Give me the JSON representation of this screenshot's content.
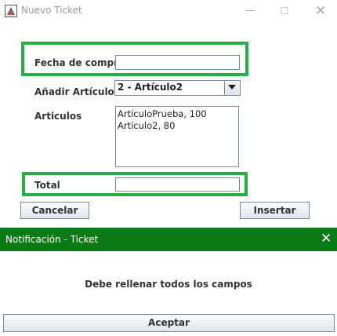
{
  "window": {
    "title": "Nuevo Ticket",
    "controls": {
      "minimize": "—",
      "maximize": "☐",
      "close": "✕"
    }
  },
  "form": {
    "purchase_date": {
      "label": "Fecha de compra",
      "value": ""
    },
    "add_items": {
      "label": "Añadir Artículos",
      "selected": "2 - Artículo2"
    },
    "items": {
      "label": "Articulos",
      "list": [
        "ArtículoPrueba, 100",
        "Artículo2, 80"
      ]
    },
    "total": {
      "label": "Total",
      "value": ""
    }
  },
  "buttons": {
    "cancel": "Cancelar",
    "insert": "Insertar"
  },
  "dialog": {
    "title": "Notificación - Ticket",
    "close": "✕",
    "message": "Debe rellenar todos los campos",
    "accept": "Aceptar"
  },
  "colors": {
    "highlight": "#27ae48",
    "dialog_titlebar": "#0a7a14"
  }
}
